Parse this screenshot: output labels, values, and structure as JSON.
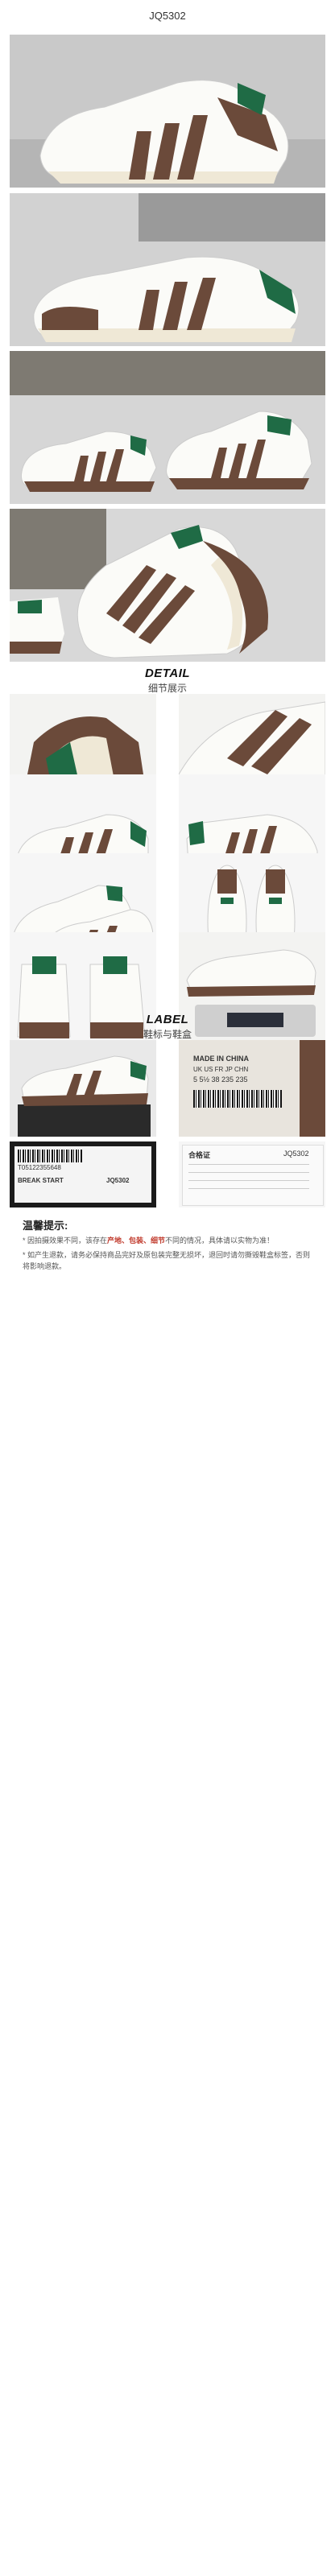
{
  "product_code": "JQ5302",
  "sections": {
    "detail": {
      "heading": "DETAIL",
      "sub": "细节展示"
    },
    "label": {
      "heading": "LABEL",
      "sub": "鞋标与鞋盒"
    }
  },
  "notice": {
    "title": "温馨提示:",
    "line1_pre": "* 因拍摄效果不同，该存在",
    "line1_highlight": "产地、包装、细节",
    "line1_post": "不同的情况，具体请以实物为准！",
    "line2": "* 如产生退款，请务必保持商品完好及原包装完整无损坏，退回时请勿撕毁鞋盒标签，否则将影响退款。"
  },
  "shoe_label": {
    "made_in": "MADE IN CHINA",
    "sizes": "UK  US  FR  JP  CHN",
    "size_values": "5  5½  38  235  235"
  },
  "box_label": {
    "model_name": "BREAK START",
    "code": "JQ5302",
    "barcode_text": "T05122355648"
  },
  "cert": {
    "title": "合格证",
    "code": "JQ5302"
  },
  "colors": {
    "brown": "#6b4a3a",
    "green": "#1f6b45",
    "cream": "#efe8d6",
    "white": "#fbfbf8",
    "accent_red": "#c0392b"
  }
}
